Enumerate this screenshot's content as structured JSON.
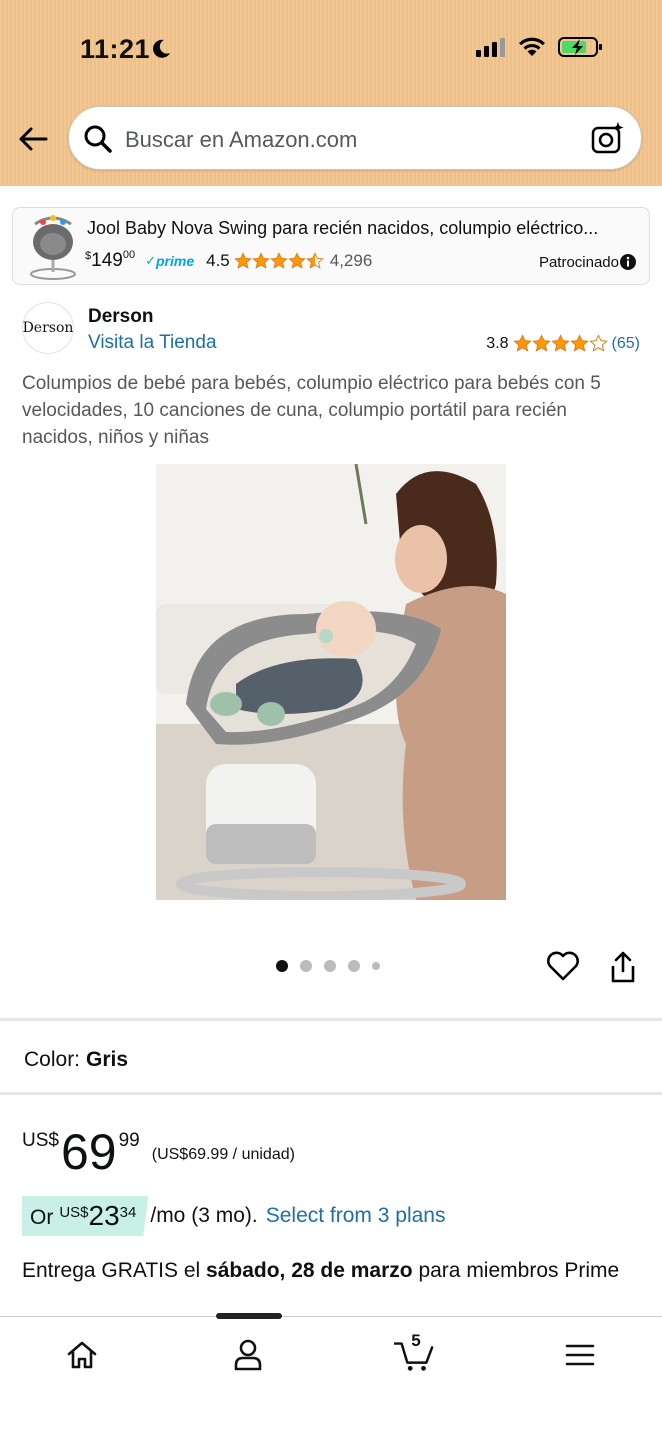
{
  "status_bar": {
    "time": "11:21"
  },
  "search": {
    "placeholder": "Buscar en Amazon.com"
  },
  "sponsored": {
    "title": "Jool Baby Nova Swing para recién nacidos, columpio eléctrico...",
    "price_currency": "$",
    "price_whole": "149",
    "price_fraction": "00",
    "prime_check": "✓",
    "prime": "prime",
    "rating": "4.5",
    "stars": 4.5,
    "review_count": "4,296",
    "label": "Patrocinado"
  },
  "brand": {
    "logo_text": "Derson",
    "name": "Derson",
    "store_link": "Visita la Tienda",
    "rating": "3.8",
    "stars": 4,
    "review_count": "(65)"
  },
  "product": {
    "title": "Columpios de bebé para bebés, columpio eléctrico para bebés con 5 velocidades, 10 canciones de cuna, columpio portátil para recién nacidos, niños y niñas"
  },
  "gallery": {
    "image_count": 5,
    "active_index": 0
  },
  "color": {
    "label": "Color:",
    "value": "Gris"
  },
  "price": {
    "currency": "US$",
    "whole": "69",
    "fraction": "99",
    "unit_price": "(US$69.99 / unidad)"
  },
  "installment": {
    "prefix": "Or",
    "currency": "US$",
    "whole": "23",
    "fraction": "34",
    "terms": "/mo (3 mo).",
    "link": "Select from 3 plans"
  },
  "delivery": {
    "prefix": "Entrega GRATIS el",
    "date": "sábado, 28 de marzo",
    "suffix": "para miembros Prime"
  },
  "bottom_nav": {
    "cart_count": "5"
  },
  "colors": {
    "header_bg": "#f2c48d",
    "link": "#1d6fa5",
    "star": "#ff9900",
    "installment_bg": "#c9f0e6"
  }
}
